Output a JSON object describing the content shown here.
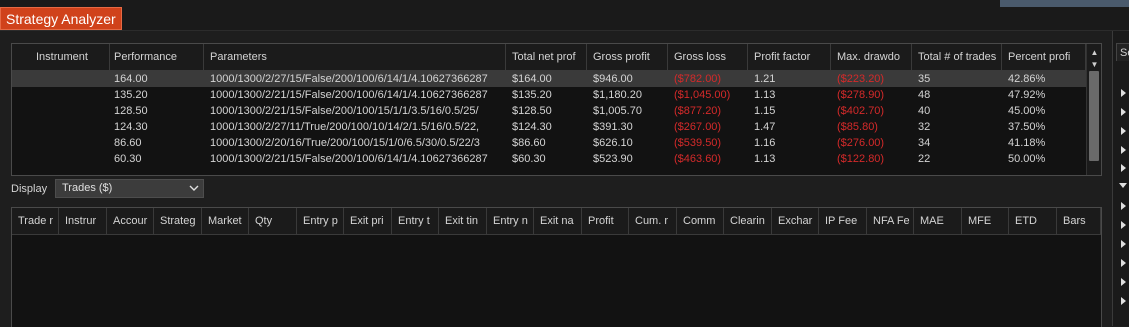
{
  "app": {
    "title": "Strategy Analyzer"
  },
  "optimization_grid": {
    "columns": [
      "Instrument",
      "Performance",
      "Parameters",
      "Total net prof",
      "Gross profit",
      "Gross loss",
      "Profit factor",
      "Max. drawdo",
      "Total # of trades",
      "Percent profi"
    ],
    "rows": [
      {
        "instrument": "",
        "performance": "164.00",
        "parameters": "1000/1300/2/27/15/False/200/100/6/14/1/4.10627366287",
        "total_net_profit": "$164.00",
        "gross_profit": "$946.00",
        "gross_loss": "($782.00)",
        "profit_factor": "1.21",
        "max_drawdown": "($223.20)",
        "total_trades": "35",
        "percent_profitable": "42.86%",
        "selected": true
      },
      {
        "instrument": "",
        "performance": "135.20",
        "parameters": "1000/1300/2/21/15/False/200/100/6/14/1/4.10627366287",
        "total_net_profit": "$135.20",
        "gross_profit": "$1,180.20",
        "gross_loss": "($1,045.00)",
        "profit_factor": "1.13",
        "max_drawdown": "($278.90)",
        "total_trades": "48",
        "percent_profitable": "47.92%"
      },
      {
        "instrument": "",
        "performance": "128.50",
        "parameters": "1000/1300/2/21/15/False/200/100/15/1/1/3.5/16/0.5/25/",
        "total_net_profit": "$128.50",
        "gross_profit": "$1,005.70",
        "gross_loss": "($877.20)",
        "profit_factor": "1.15",
        "max_drawdown": "($402.70)",
        "total_trades": "40",
        "percent_profitable": "45.00%"
      },
      {
        "instrument": "",
        "performance": "124.30",
        "parameters": "1000/1300/2/27/11/True/200/100/10/14/2/1.5/16/0.5/22,",
        "total_net_profit": "$124.30",
        "gross_profit": "$391.30",
        "gross_loss": "($267.00)",
        "profit_factor": "1.47",
        "max_drawdown": "($85.80)",
        "total_trades": "32",
        "percent_profitable": "37.50%"
      },
      {
        "instrument": "",
        "performance": "86.60",
        "parameters": "1000/1300/2/20/16/True/200/100/15/1/0/6.5/30/0.5/22/3",
        "total_net_profit": "$86.60",
        "gross_profit": "$626.10",
        "gross_loss": "($539.50)",
        "profit_factor": "1.16",
        "max_drawdown": "($276.00)",
        "total_trades": "34",
        "percent_profitable": "41.18%"
      },
      {
        "instrument": "",
        "performance": "60.30",
        "parameters": "1000/1300/2/21/15/False/200/100/6/14/1/4.10627366287",
        "total_net_profit": "$60.30",
        "gross_profit": "$523.90",
        "gross_loss": "($463.60)",
        "profit_factor": "1.13",
        "max_drawdown": "($122.80)",
        "total_trades": "22",
        "percent_profitable": "50.00%"
      }
    ]
  },
  "display": {
    "label": "Display",
    "selected": "Trades ($)"
  },
  "trades_grid": {
    "columns": [
      "Trade r",
      "Instrur",
      "Accour",
      "Strateg",
      "Market",
      "Qty",
      "Entry p",
      "Exit pri",
      "Entry t",
      "Exit tin",
      "Entry n",
      "Exit na",
      "Profit",
      "Cum. r",
      "Comm",
      "Clearin",
      "Exchar",
      "IP Fee",
      "NFA Fe",
      "MAE",
      "MFE",
      "ETD",
      "Bars"
    ]
  },
  "side_panel": {
    "label": "Se"
  },
  "colors": {
    "accent": "#d0421b",
    "negative": "#d42a2a",
    "background": "#1e1e1e"
  }
}
